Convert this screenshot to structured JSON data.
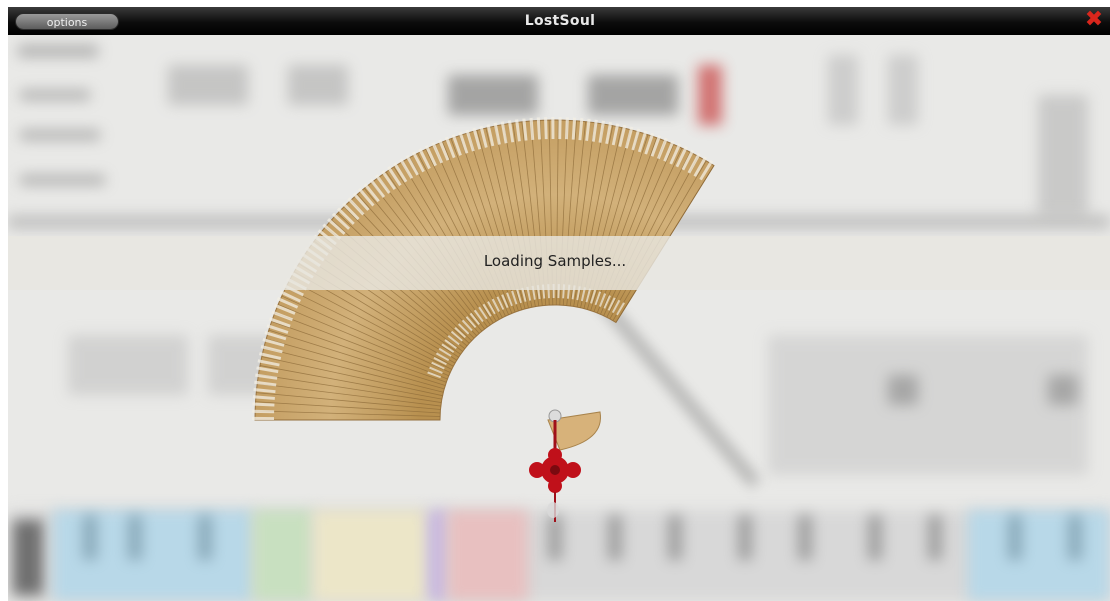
{
  "window": {
    "title": "LostSoul",
    "options_label": "options",
    "close_glyph": "✖"
  },
  "status": {
    "message": "Loading Samples..."
  },
  "icons": {
    "close": "close-icon",
    "fan": "folding-fan-icon",
    "knot": "chinese-knot-icon"
  },
  "colors": {
    "title_bar": "#000000",
    "close_accent": "#d9261c",
    "fan_wood": "#c9a86e",
    "knot_red": "#c0101a"
  }
}
